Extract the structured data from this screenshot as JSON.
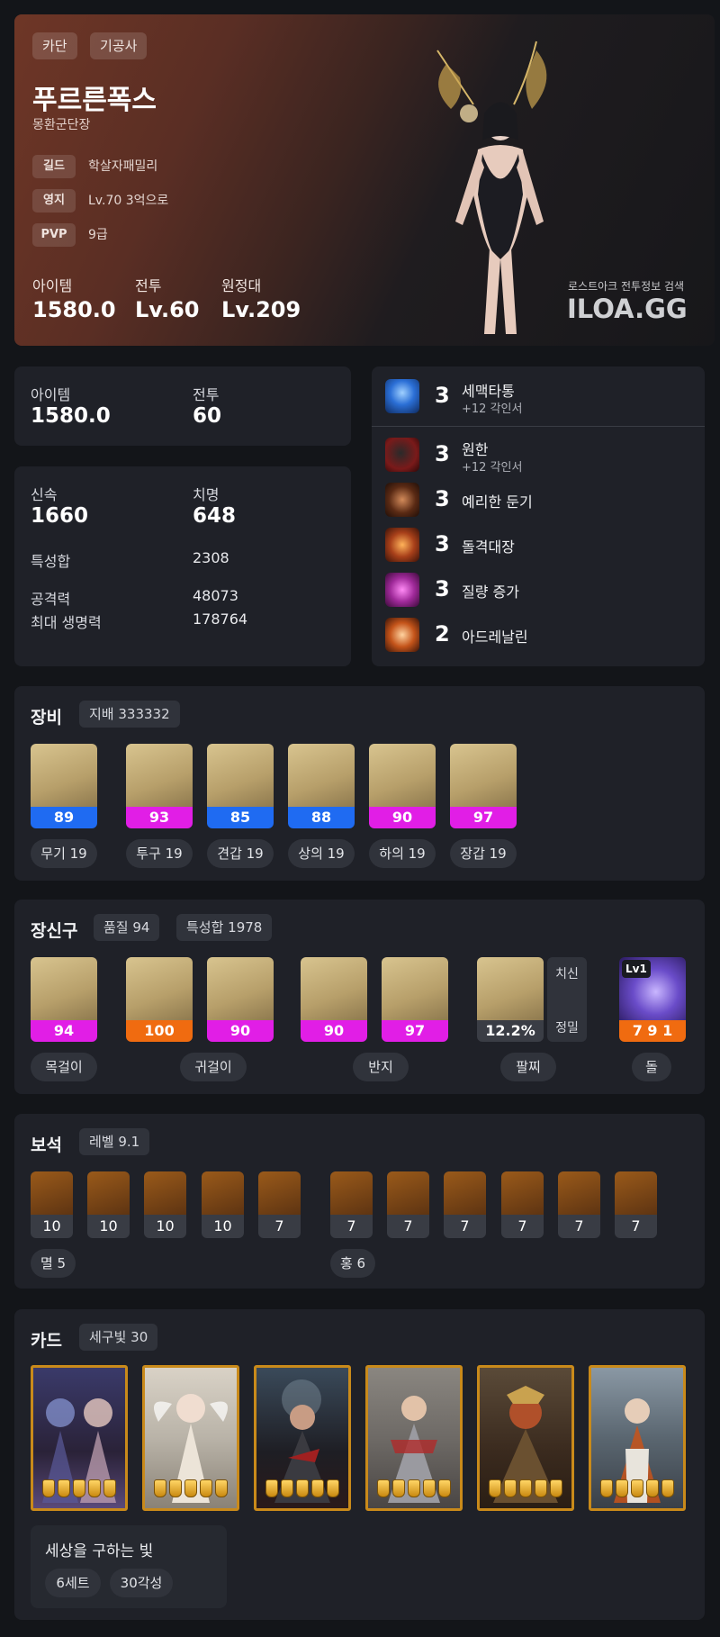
{
  "hero": {
    "tags": [
      "카단",
      "기공사"
    ],
    "name": "푸르른폭스",
    "title": "몽환군단장",
    "rows": [
      {
        "label": "길드",
        "value": "학살자패밀리"
      },
      {
        "label": "영지",
        "value": "Lv.70 3억으로"
      },
      {
        "label": "PVP",
        "value": "9급"
      }
    ],
    "stats": [
      {
        "label": "아이템",
        "value": "1580.0"
      },
      {
        "label": "전투",
        "value": "Lv.60"
      },
      {
        "label": "원정대",
        "value": "Lv.209"
      }
    ],
    "watermark_small": "로스트아크 전투정보 검색",
    "watermark_big": "ILOA.GG"
  },
  "summary": {
    "item_label": "아이템",
    "item_value": "1580.0",
    "combat_label": "전투",
    "combat_value": "60"
  },
  "stats": {
    "swift_label": "신속",
    "swift_value": "1660",
    "crit_label": "치명",
    "crit_value": "648",
    "total_label": "특성합",
    "total_value": "2308",
    "atk_label": "공격력",
    "atk_value": "48073",
    "hp_label": "최대 생명력",
    "hp_value": "178764"
  },
  "engravings": [
    {
      "level": "3",
      "name": "세맥타통",
      "sub": "+12 각인서",
      "icon": "meridian-icon",
      "color": "#2b6fd6"
    },
    {
      "level": "3",
      "name": "원한",
      "sub": "+12 각인서",
      "icon": "grudge-icon",
      "color": "#7a1a1a"
    },
    {
      "level": "3",
      "name": "예리한 둔기",
      "sub": "",
      "icon": "keen-blunt-icon",
      "color": "#5a2a14"
    },
    {
      "level": "3",
      "name": "돌격대장",
      "sub": "",
      "icon": "raid-captain-icon",
      "color": "#a8401a"
    },
    {
      "level": "3",
      "name": "질량 증가",
      "sub": "",
      "icon": "mass-increase-icon",
      "color": "#a02a9a"
    },
    {
      "level": "2",
      "name": "아드레날린",
      "sub": "",
      "icon": "adrenaline-icon",
      "color": "#c4541a"
    }
  ],
  "equipment": {
    "title": "장비",
    "set_chip": "지배 333332",
    "items": [
      {
        "quality": "89",
        "label": "무기 19",
        "color": "blue",
        "icon": "weapon-icon"
      },
      {
        "quality": "93",
        "label": "투구 19",
        "color": "pink",
        "icon": "helmet-icon"
      },
      {
        "quality": "85",
        "label": "견갑 19",
        "color": "blue",
        "icon": "shoulder-icon"
      },
      {
        "quality": "88",
        "label": "상의 19",
        "color": "blue",
        "icon": "chest-icon"
      },
      {
        "quality": "90",
        "label": "하의 19",
        "color": "pink",
        "icon": "pants-icon"
      },
      {
        "quality": "97",
        "label": "장갑 19",
        "color": "pink",
        "icon": "gloves-icon"
      }
    ]
  },
  "accessories": {
    "title": "장신구",
    "quality_chip": "품질 94",
    "stat_chip": "특성합 1978",
    "items": [
      {
        "quality": "94",
        "color": "pink",
        "icon": "necklace-icon"
      },
      {
        "quality": "100",
        "color": "orange",
        "icon": "earring-icon"
      },
      {
        "quality": "90",
        "color": "pink",
        "icon": "earring-icon"
      },
      {
        "quality": "90",
        "color": "pink",
        "icon": "ring-icon"
      },
      {
        "quality": "97",
        "color": "pink",
        "icon": "ring-icon"
      }
    ],
    "bracelet": {
      "value": "12.2%",
      "opt1": "치신",
      "opt2": "정밀"
    },
    "stone": {
      "badge": "Lv1",
      "value": "7 9 1"
    },
    "labels": [
      "목걸이",
      "귀걸이",
      "반지",
      "팔찌",
      "돌"
    ]
  },
  "gems": {
    "title": "보석",
    "level_chip": "레벨 9.1",
    "left": [
      "10",
      "10",
      "10",
      "10",
      "7"
    ],
    "right": [
      "7",
      "7",
      "7",
      "7",
      "7",
      "7"
    ],
    "left_label": "멸 5",
    "right_label": "홍 6"
  },
  "cards": {
    "title": "카드",
    "chip": "세구빛 30",
    "items": [
      {
        "name": "card-1",
        "bg": "#3a3a6a"
      },
      {
        "name": "card-2",
        "bg": "#b9b3a8"
      },
      {
        "name": "card-3",
        "bg": "#2a2a30"
      },
      {
        "name": "card-4",
        "bg": "#6e6a66"
      },
      {
        "name": "card-5",
        "bg": "#4a3a2a"
      },
      {
        "name": "card-6",
        "bg": "#5a6670"
      }
    ],
    "set_name": "세상을 구하는 빛",
    "set_chips": [
      "6세트",
      "30각성"
    ]
  }
}
